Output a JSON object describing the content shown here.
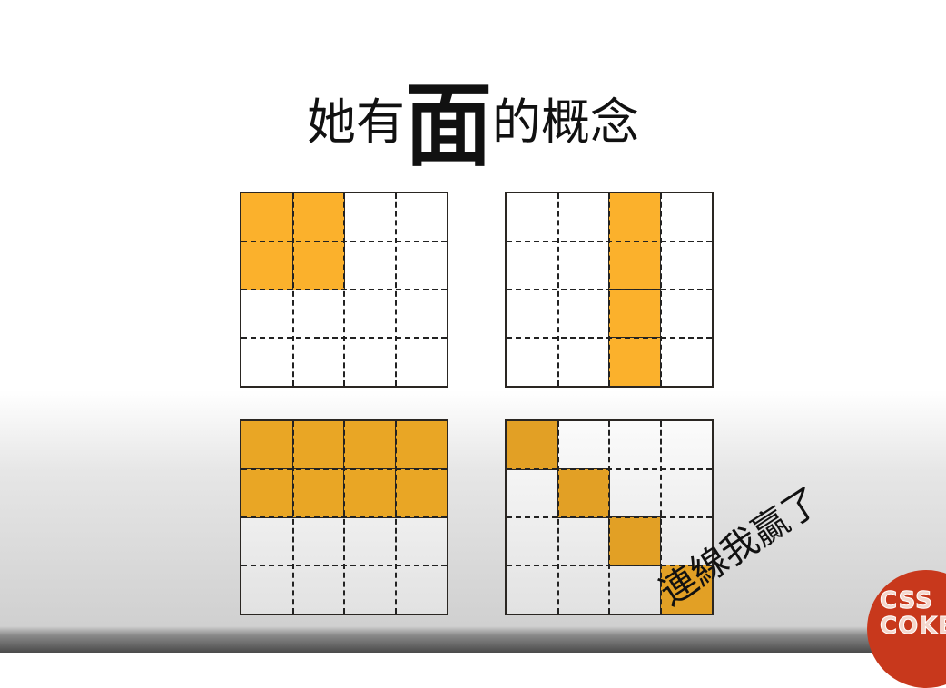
{
  "title": {
    "before": "她有",
    "emphasis": "面",
    "after": "的概念"
  },
  "diagrams": [
    {
      "name": "top-left-grid",
      "rows": 4,
      "cols": 4,
      "filled": [
        [
          0,
          0
        ],
        [
          0,
          1
        ],
        [
          1,
          0
        ],
        [
          1,
          1
        ]
      ],
      "fill_color": "#fbb12c"
    },
    {
      "name": "top-right-grid",
      "rows": 4,
      "cols": 4,
      "filled": [
        [
          0,
          2
        ],
        [
          1,
          2
        ],
        [
          2,
          2
        ],
        [
          3,
          2
        ]
      ],
      "fill_color": "#fbb12c"
    },
    {
      "name": "bottom-left-grid",
      "rows": 4,
      "cols": 4,
      "filled": [
        [
          0,
          0
        ],
        [
          0,
          1
        ],
        [
          0,
          2
        ],
        [
          0,
          3
        ],
        [
          1,
          0
        ],
        [
          1,
          1
        ],
        [
          1,
          2
        ],
        [
          1,
          3
        ]
      ],
      "fill_color": "#e9a625"
    },
    {
      "name": "bottom-right-grid",
      "rows": 4,
      "cols": 4,
      "filled": [
        [
          0,
          0
        ],
        [
          1,
          1
        ],
        [
          2,
          2
        ],
        [
          3,
          3
        ]
      ],
      "fill_color": "#e2a025"
    }
  ],
  "caption": "連線我贏了",
  "logo": {
    "line1": "CSS",
    "line2": "COKE",
    "color": "#c8381c"
  }
}
